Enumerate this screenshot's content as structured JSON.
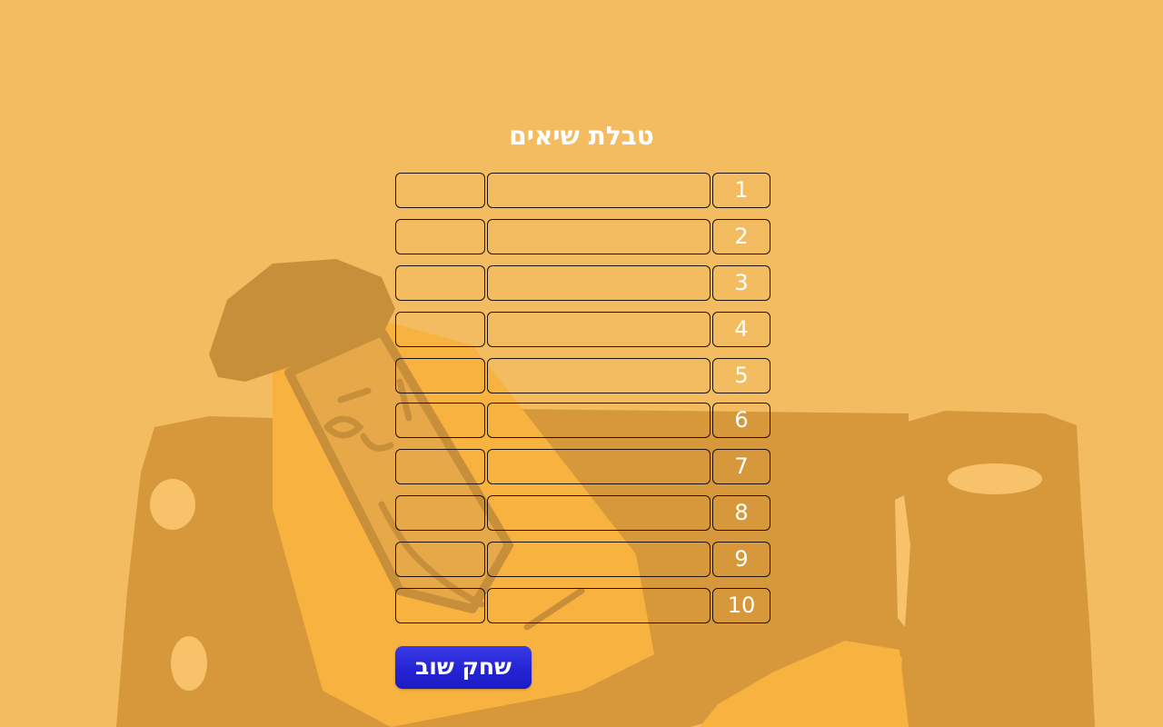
{
  "title": "טבלת שיאים",
  "scores": [
    {
      "rank": "1",
      "name": "",
      "score": ""
    },
    {
      "rank": "2",
      "name": "",
      "score": ""
    },
    {
      "rank": "3",
      "name": "",
      "score": ""
    },
    {
      "rank": "4",
      "name": "",
      "score": ""
    },
    {
      "rank": "5",
      "name": "",
      "score": ""
    },
    {
      "rank": "6",
      "name": "",
      "score": ""
    },
    {
      "rank": "7",
      "name": "",
      "score": ""
    },
    {
      "rank": "8",
      "name": "",
      "score": ""
    },
    {
      "rank": "9",
      "name": "",
      "score": ""
    },
    {
      "rank": "10",
      "name": "",
      "score": ""
    }
  ],
  "play_again_label": "שחק שוב",
  "colors": {
    "background": "#f4bc61",
    "illustration_dark": "#d6983a",
    "illustration_light": "#f8b240",
    "cell_border": "#1d1203",
    "button": "#2424d4",
    "text": "#ffffff"
  }
}
